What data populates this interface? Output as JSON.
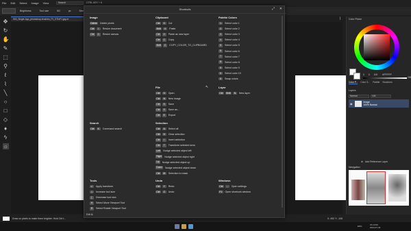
{
  "menubar": {
    "items": [
      "File",
      "Edit",
      "Select",
      "Image",
      "View"
    ],
    "search_placeholder": "Search",
    "shortcut_hint": "CTRL KEY + K"
  },
  "brushbar": {
    "items": [
      "Brightness",
      "Tool size",
      "5G",
      "px",
      "Strength"
    ]
  },
  "document_tab": "503_Single-App_photoshop-brushes_P1_ETIeF1.jpg.re",
  "right_panel": {
    "color_picker_title": "Color Picker",
    "hsv_values": [
      "0",
      "0",
      "100"
    ],
    "hex": "#FFFFFF",
    "slider_value": "255",
    "tabs": [
      "Color P...",
      "Color S...",
      "Palette",
      "Swatches"
    ],
    "layers_title": "Layers",
    "blend_mode": "Normal",
    "opacity": "100",
    "layer_name": "Image",
    "layer_meta": "100% Normal",
    "add_fill_label": "Add Reference Layer",
    "navigation_title": "Navigation"
  },
  "status": {
    "hint": "Draw on pixels to make them brighter. Hold Ctrl t...",
    "coords": "X: 492 Y: -106"
  },
  "taskbar": {
    "lang": "ENG",
    "time": "15:13:00",
    "date": "2024-07-03"
  },
  "shortcuts": {
    "title": "Shortcuts",
    "image": {
      "title": "Image",
      "rows": [
        {
          "keys": [
            "Delete"
          ],
          "desc": "Delete pixels"
        },
        {
          "keys": [
            "Ctrl",
            "I"
          ],
          "desc": "Resize document"
        },
        {
          "keys": [
            "Ctrl",
            "C"
          ],
          "desc": "Resize canvas"
        }
      ]
    },
    "clipboard": {
      "title": "Clipboard",
      "rows": [
        {
          "keys": [
            "Ctrl",
            "X"
          ],
          "desc": "Cut"
        },
        {
          "keys": [
            "Shift",
            "V"
          ],
          "desc": "Paste"
        },
        {
          "keys": [
            "Ctrl",
            "V"
          ],
          "desc": "Paste as new layer"
        },
        {
          "keys": [
            "Ctrl",
            "C"
          ],
          "desc": "Copy"
        },
        {
          "keys": [
            "Shift",
            "C"
          ],
          "desc": "COPY_COLOR_TO_CLIPBOARD"
        }
      ]
    },
    "palette": {
      "title": "Palette Colors",
      "rows": [
        {
          "keys": [
            "1"
          ],
          "desc": "Select color 1"
        },
        {
          "keys": [
            "2"
          ],
          "desc": "Select color 2"
        },
        {
          "keys": [
            "3"
          ],
          "desc": "Select color 3"
        },
        {
          "keys": [
            "4"
          ],
          "desc": "Select color 4"
        },
        {
          "keys": [
            "5"
          ],
          "desc": "Select color 5"
        },
        {
          "keys": [
            "6"
          ],
          "desc": "Select color 6"
        },
        {
          "keys": [
            "7"
          ],
          "desc": "Select color 7"
        },
        {
          "keys": [
            "8"
          ],
          "desc": "Select color 8"
        },
        {
          "keys": [
            "9"
          ],
          "desc": "Select color 9"
        },
        {
          "keys": [
            "0"
          ],
          "desc": "Select color 10"
        },
        {
          "keys": [
            "X"
          ],
          "desc": "Swap colors"
        }
      ]
    },
    "file": {
      "title": "File",
      "rows": [
        {
          "keys": [
            "Ctrl",
            "O"
          ],
          "desc": "Open"
        },
        {
          "keys": [
            "Ctrl",
            "N"
          ],
          "desc": "New image"
        },
        {
          "keys": [
            "Ctrl",
            "S"
          ],
          "desc": "Save"
        },
        {
          "keys": [
            "Ctrl",
            "S"
          ],
          "desc": "Save as..."
        },
        {
          "keys": [
            "Ctrl",
            "E"
          ],
          "desc": "Export"
        }
      ]
    },
    "layer": {
      "title": "Layer",
      "rows": [
        {
          "keys": [
            "Ctrl",
            "Shift",
            "N"
          ],
          "desc": "New layer"
        }
      ]
    },
    "search": {
      "title": "Search",
      "rows": [
        {
          "keys": [
            "Ctrl",
            "K"
          ],
          "desc": "Command search"
        }
      ]
    },
    "selection": {
      "title": "Selection",
      "rows": [
        {
          "keys": [
            "Ctrl",
            "A"
          ],
          "desc": "Select all"
        },
        {
          "keys": [
            "Ctrl",
            "D"
          ],
          "desc": "Clear selection"
        },
        {
          "keys": [
            "Ctrl",
            "I"
          ],
          "desc": "Invert selection"
        },
        {
          "keys": [
            "Ctrl",
            "T"
          ],
          "desc": "Transform selected area"
        },
        {
          "keys": [
            "Left"
          ],
          "desc": "Nudge selected object left"
        },
        {
          "keys": [
            "Right"
          ],
          "desc": "Nudge selected object right"
        },
        {
          "keys": [
            "Up"
          ],
          "desc": "Nudge selected object up"
        },
        {
          "keys": [
            "Down"
          ],
          "desc": "Nudge selected object down"
        },
        {
          "keys": [
            "Ctrl",
            "M"
          ],
          "desc": "Selection to mask"
        }
      ]
    },
    "tools": {
      "title": "Tools",
      "rows": [
        {
          "keys": [
            "↵"
          ],
          "desc": "Apply transform"
        },
        {
          "keys": [
            "]"
          ],
          "desc": "Increase tool size"
        },
        {
          "keys": [
            "["
          ],
          "desc": "Decrease tool size"
        },
        {
          "keys": [
            "H"
          ],
          "desc": "Select Move Viewport Tool"
        },
        {
          "keys": [
            "R"
          ],
          "desc": "Select Rotate Viewport Tool"
        }
      ]
    },
    "undo": {
      "title": "Undo",
      "rows": [
        {
          "keys": [
            "Ctrl",
            "Y"
          ],
          "desc": "Redo"
        },
        {
          "keys": [
            "Ctrl",
            "Z"
          ],
          "desc": "Undo"
        }
      ]
    },
    "windows": {
      "title": "Windows",
      "rows": [
        {
          "keys": [
            "Ctrl",
            ","
          ],
          "desc": "Open settings"
        },
        {
          "keys": [
            "F1"
          ],
          "desc": "Open shortcuts window"
        }
      ]
    },
    "edit_label": "Edit"
  }
}
